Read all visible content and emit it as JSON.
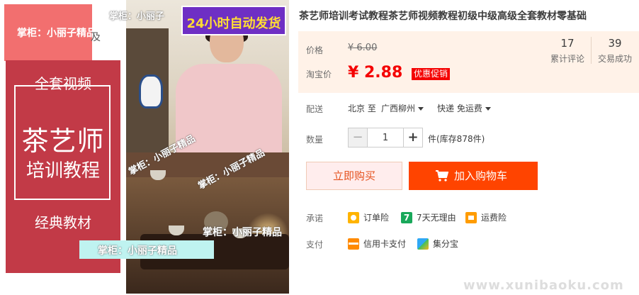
{
  "image_overlays": {
    "seller_tab": "掌柜：小丽子精品",
    "partial_char": "及",
    "badge_24h": "24小时自动发货",
    "watermark_top": "掌柜：小丽子",
    "watermark_diag_1": "掌柜：小丽子精品",
    "watermark_diag_2": "掌柜：小丽子精品",
    "watermark_plain": "掌柜：小丽子精品",
    "watermark_bar": "掌柜：小丽子精品",
    "cover_full_set": "全套视频",
    "cover_main": "茶艺师",
    "cover_sub": "培训教程",
    "cover_classic": "经典教材"
  },
  "product": {
    "title": "茶艺师培训考试教程茶艺师视频教程初级中级高级全套教材零基础"
  },
  "price": {
    "price_label": "价格",
    "original_price": "¥ 6.00",
    "promo_label": "淘宝价",
    "promo_price": "¥ 2.88",
    "promo_tag": "优惠促销"
  },
  "stats": {
    "reviews_count": "17",
    "reviews_label": "累计评论",
    "sales_count": "39",
    "sales_label": "交易成功"
  },
  "shipping": {
    "label": "配送",
    "from_text": "北京 至",
    "destination": "广西柳州",
    "method": "快递 免运费"
  },
  "quantity": {
    "label": "数量",
    "minus": "−",
    "value": "1",
    "plus": "+",
    "stock_text": "件(库存878件)"
  },
  "actions": {
    "buy_now": "立即购买",
    "add_to_cart": "加入购物车"
  },
  "promise": {
    "label": "承诺",
    "items": [
      "订单险",
      "7天无理由",
      "运费险"
    ],
    "seven_day_glyph": "7"
  },
  "payment": {
    "label": "支付",
    "items": [
      "信用卡支付",
      "集分宝"
    ]
  },
  "site_watermark": "www.xunibaoku.com",
  "colors": {
    "accent_red": "#f40000",
    "cart_orange": "#ff4400",
    "price_bg": "#fff2e8"
  }
}
